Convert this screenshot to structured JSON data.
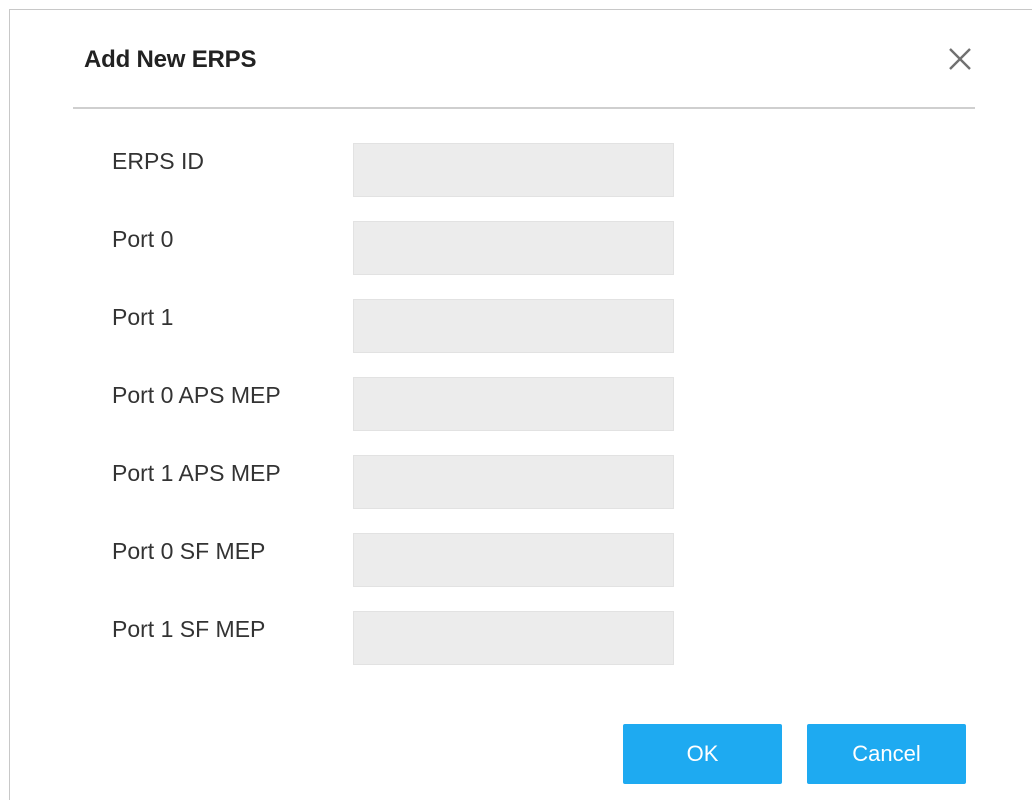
{
  "dialog": {
    "title": "Add New ERPS",
    "close_icon": "close-icon"
  },
  "fields": [
    {
      "label": "ERPS ID",
      "value": "",
      "placeholder": ""
    },
    {
      "label": "Port 0",
      "value": "",
      "placeholder": ""
    },
    {
      "label": "Port 1",
      "value": "",
      "placeholder": ""
    },
    {
      "label": "Port 0 APS MEP",
      "value": "",
      "placeholder": ""
    },
    {
      "label": "Port 1 APS MEP",
      "value": "",
      "placeholder": ""
    },
    {
      "label": "Port 0 SF MEP",
      "value": "",
      "placeholder": ""
    },
    {
      "label": "Port 1 SF MEP",
      "value": "",
      "placeholder": ""
    }
  ],
  "buttons": {
    "ok_label": "OK",
    "cancel_label": "Cancel"
  },
  "colors": {
    "accent": "#1eaaf1",
    "input_background": "#ececec",
    "divider": "#cfcfcf"
  }
}
